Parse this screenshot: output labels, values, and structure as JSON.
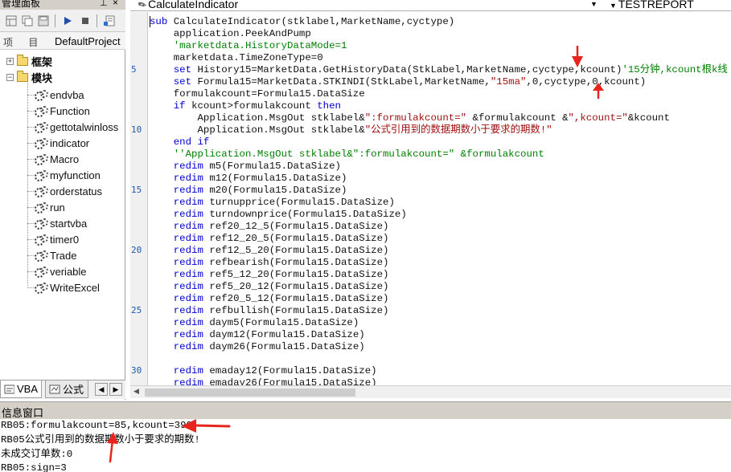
{
  "left_panel": {
    "title": "管理面板",
    "pin_icon": "pin-icon",
    "close_icon": "close-icon",
    "toolbar": [
      "grid-icon",
      "copy-icon",
      "save-icon",
      "run-icon",
      "stop-icon",
      "properties-icon"
    ],
    "project_label": "项 目",
    "project_name": "DefaultProject",
    "folders": [
      {
        "label": "框架",
        "expander": "⊞"
      },
      {
        "label": "模块",
        "expander": "⊟"
      }
    ],
    "modules": [
      "endvba",
      "Function",
      "gettotalwinloss",
      "indicator",
      "Macro",
      "myfunction",
      "orderstatus",
      "run",
      "startvba",
      "timer0",
      "Trade",
      "veriable",
      "WriteExcel"
    ],
    "tabs": [
      {
        "label": "VBA"
      },
      {
        "label": "公式"
      }
    ]
  },
  "editor": {
    "procedure": "CalculateIndicator",
    "report": "TESTREPORT",
    "line_numbers": [
      {
        "n": "5",
        "row": 4
      },
      {
        "n": "10",
        "row": 9
      },
      {
        "n": "15",
        "row": 14
      },
      {
        "n": "20",
        "row": 19
      },
      {
        "n": "25",
        "row": 24
      },
      {
        "n": "30",
        "row": 29
      }
    ],
    "lines": [
      [
        {
          "t": "sub ",
          "c": "kw"
        },
        {
          "t": "CalculateIndicator(stklabel,MarketName,cyctype)"
        }
      ],
      [
        {
          "t": "    application.PeekAndPump"
        }
      ],
      [
        {
          "t": "    'marketdata.HistoryDataMode=1",
          "c": "cm"
        }
      ],
      [
        {
          "t": "    marketdata.TimeZoneType=0"
        }
      ],
      [
        {
          "t": "    "
        },
        {
          "t": "set ",
          "c": "kw"
        },
        {
          "t": "History15=MarketData.GetHistoryData(StkLabel,MarketName,cyctype,kcount)"
        },
        {
          "t": "'15分钟,kcount根k线",
          "c": "cm"
        }
      ],
      [
        {
          "t": "    "
        },
        {
          "t": "set ",
          "c": "kw"
        },
        {
          "t": "Formula15=MarketData.STKINDI(StkLabel,MarketName,"
        },
        {
          "t": "\"15ma\"",
          "c": "st"
        },
        {
          "t": ",0,cyctype,0,kcount)"
        }
      ],
      [
        {
          "t": "    formulakcount=Formula15.DataSize"
        }
      ],
      [
        {
          "t": "    "
        },
        {
          "t": "if ",
          "c": "kw"
        },
        {
          "t": "kcount>formulakcount "
        },
        {
          "t": "then",
          "c": "kw"
        }
      ],
      [
        {
          "t": "        Application.MsgOut stklabel&"
        },
        {
          "t": "\":formulakcount=\"",
          "c": "st"
        },
        {
          "t": " &formulakcount &"
        },
        {
          "t": "\",kcount=\"",
          "c": "st"
        },
        {
          "t": "&kcount"
        }
      ],
      [
        {
          "t": "        Application.MsgOut stklabel&"
        },
        {
          "t": "\"公式引用到的数据期数小于要求的期数!\"",
          "c": "st"
        }
      ],
      [
        {
          "t": "    "
        },
        {
          "t": "end if",
          "c": "kw"
        }
      ],
      [
        {
          "t": "    ''Application.MsgOut stklabel&\":formulakcount=\" &formulakcount",
          "c": "cm"
        }
      ],
      [
        {
          "t": "    "
        },
        {
          "t": "redim ",
          "c": "kw"
        },
        {
          "t": "m5(Formula15.DataSize)"
        }
      ],
      [
        {
          "t": "    "
        },
        {
          "t": "redim ",
          "c": "kw"
        },
        {
          "t": "m12(Formula15.DataSize)"
        }
      ],
      [
        {
          "t": "    "
        },
        {
          "t": "redim ",
          "c": "kw"
        },
        {
          "t": "m20(Formula15.DataSize)"
        }
      ],
      [
        {
          "t": "    "
        },
        {
          "t": "redim ",
          "c": "kw"
        },
        {
          "t": "turnupprice(Formula15.DataSize)"
        }
      ],
      [
        {
          "t": "    "
        },
        {
          "t": "redim ",
          "c": "kw"
        },
        {
          "t": "turndownprice(Formula15.DataSize)"
        }
      ],
      [
        {
          "t": "    "
        },
        {
          "t": "redim ",
          "c": "kw"
        },
        {
          "t": "ref20_12_5(Formula15.DataSize)"
        }
      ],
      [
        {
          "t": "    "
        },
        {
          "t": "redim ",
          "c": "kw"
        },
        {
          "t": "ref12_20_5(Formula15.DataSize)"
        }
      ],
      [
        {
          "t": "    "
        },
        {
          "t": "redim ",
          "c": "kw"
        },
        {
          "t": "ref12_5_20(Formula15.DataSize)"
        }
      ],
      [
        {
          "t": "    "
        },
        {
          "t": "redim ",
          "c": "kw"
        },
        {
          "t": "refbearish(Formula15.DataSize)"
        }
      ],
      [
        {
          "t": "    "
        },
        {
          "t": "redim ",
          "c": "kw"
        },
        {
          "t": "ref5_12_20(Formula15.DataSize)"
        }
      ],
      [
        {
          "t": "    "
        },
        {
          "t": "redim ",
          "c": "kw"
        },
        {
          "t": "ref5_20_12(Formula15.DataSize)"
        }
      ],
      [
        {
          "t": "    "
        },
        {
          "t": "redim ",
          "c": "kw"
        },
        {
          "t": "ref20_5_12(Formula15.DataSize)"
        }
      ],
      [
        {
          "t": "    "
        },
        {
          "t": "redim ",
          "c": "kw"
        },
        {
          "t": "refbullish(Formula15.DataSize)"
        }
      ],
      [
        {
          "t": "    "
        },
        {
          "t": "redim ",
          "c": "kw"
        },
        {
          "t": "daym5(Formula15.DataSize)"
        }
      ],
      [
        {
          "t": "    "
        },
        {
          "t": "redim ",
          "c": "kw"
        },
        {
          "t": "daym12(Formula15.DataSize)"
        }
      ],
      [
        {
          "t": "    "
        },
        {
          "t": "redim ",
          "c": "kw"
        },
        {
          "t": "daym26(Formula15.DataSize)"
        }
      ],
      [
        {
          "t": ""
        }
      ],
      [
        {
          "t": "    "
        },
        {
          "t": "redim ",
          "c": "kw"
        },
        {
          "t": "emaday12(Formula15.DataSize)"
        }
      ],
      [
        {
          "t": "    "
        },
        {
          "t": "redim ",
          "c": "kw"
        },
        {
          "t": "emaday26(Formula15.DataSize)"
        }
      ]
    ]
  },
  "info": {
    "title": "信息窗口",
    "lines": [
      "RB05:formulakcount=85,kcount=399",
      "RB05公式引用到的数据期数小于要求的期数!",
      "未成交订单数:0",
      "RB05:sign=3"
    ]
  },
  "colors": {
    "annotation_arrow": "#e8251c",
    "keyword": "#0000d0",
    "comment": "#008000",
    "string": "#a01010"
  }
}
